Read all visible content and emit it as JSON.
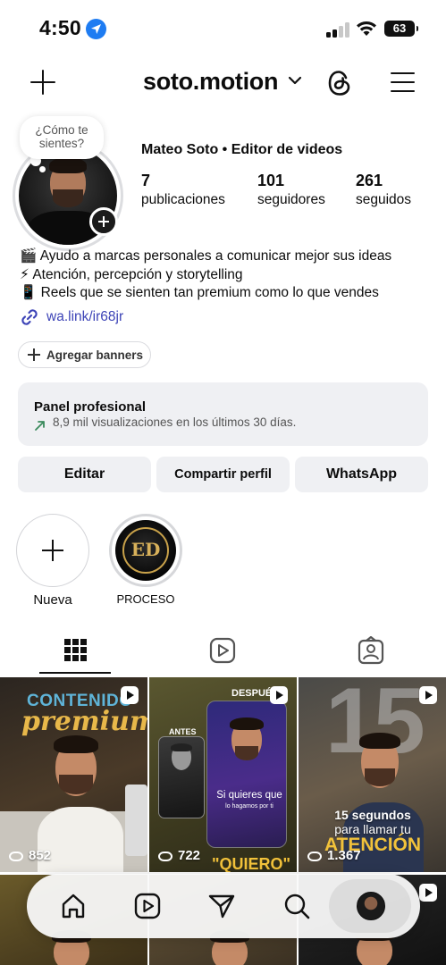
{
  "status_bar": {
    "time": "4:50",
    "battery": "63"
  },
  "header": {
    "username": "soto.motion"
  },
  "profile": {
    "note": "¿Cómo te sientes?",
    "full_name": "Mateo Soto • Editor de videos",
    "stats": [
      {
        "value": "7",
        "label": "publicaciones"
      },
      {
        "value": "101",
        "label": "seguidores"
      },
      {
        "value": "261",
        "label": "seguidos"
      }
    ],
    "bio": [
      "🎬 Ayudo a marcas personales a comunicar mejor sus ideas",
      "⚡ Atención, percepción y storytelling",
      "📱 Reels que se sienten tan premium como lo que vendes"
    ],
    "link": "wa.link/ir68jr"
  },
  "banners_button": "Agregar banners",
  "panel": {
    "title": "Panel profesional",
    "subtitle": "8,9 mil visualizaciones en los últimos 30 días."
  },
  "actions": {
    "edit": "Editar",
    "share": "Compartir perfil",
    "whatsapp": "WhatsApp"
  },
  "highlights": [
    {
      "label": "Nueva"
    },
    {
      "label": "PROCESO",
      "monogram": "ED"
    }
  ],
  "grid": [
    {
      "views": "852",
      "overlay_top": "CONTENIDO",
      "overlay_sub": "premium",
      "bg": "#3a2e22"
    },
    {
      "views": "722",
      "label_despues": "DESPUÉS",
      "label_antes": "ANTES",
      "caption": "Si quieres que",
      "caption_small": "lo hagamos por ti",
      "bottom_word": "\"QUIERO\"",
      "bg": "#4d4a25"
    },
    {
      "views": "1.367",
      "big_number": "15",
      "line1": "15 segundos",
      "line2": "para llamar tu",
      "line3": "ATENCIÓN",
      "bg": "#5a5048"
    }
  ],
  "colors": {
    "link": "#3d44b7",
    "panel_bg": "#eff0f3",
    "accent_yellow": "#f2c23a"
  }
}
